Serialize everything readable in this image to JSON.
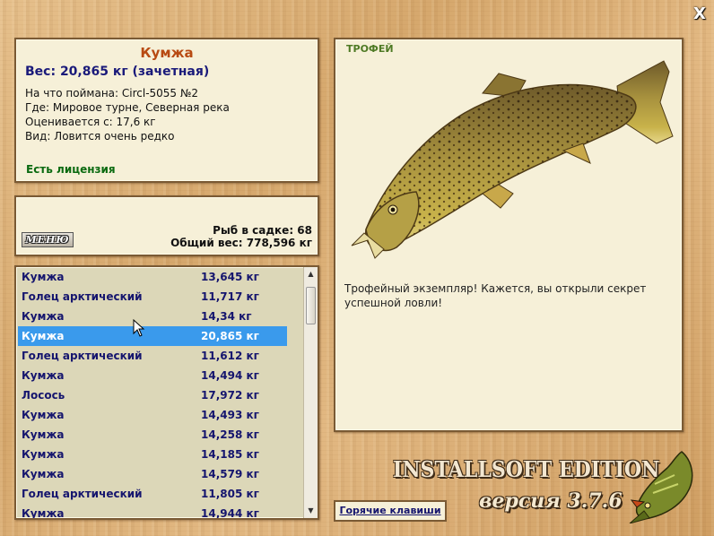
{
  "close_label": "X",
  "info": {
    "name": "Кумжа",
    "weight": "Вес: 20,865 кг (зачетная)",
    "lines": [
      "На что поймана: Circl-5055 №2",
      "Где: Мировое турне, Северная река",
      "Оценивается с: 17,6 кг",
      "Вид: Ловится очень редко"
    ],
    "license": "Есть лицензия"
  },
  "status": {
    "menu_label": "МЕНЮ",
    "fish_count": "Рыб в садке: 68",
    "total_weight": "Общий вес: 778,596 кг"
  },
  "catches": [
    {
      "name": "Кумжа",
      "weight": "13,645 кг"
    },
    {
      "name": "Голец арктический",
      "weight": "11,717 кг"
    },
    {
      "name": "Кумжа",
      "weight": "14,34 кг"
    },
    {
      "name": "Кумжа",
      "weight": "20,865 кг",
      "selected": true
    },
    {
      "name": "Голец арктический",
      "weight": "11,612 кг"
    },
    {
      "name": "Кумжа",
      "weight": "14,494 кг"
    },
    {
      "name": "Лосось",
      "weight": "17,972 кг"
    },
    {
      "name": "Кумжа",
      "weight": "14,493 кг"
    },
    {
      "name": "Кумжа",
      "weight": "14,258 кг"
    },
    {
      "name": "Кумжа",
      "weight": "14,185 кг"
    },
    {
      "name": "Кумжа",
      "weight": "14,579 кг"
    },
    {
      "name": "Голец арктический",
      "weight": "11,805 кг"
    },
    {
      "name": "Кумжа",
      "weight": "14,944 кг"
    }
  ],
  "trophy": {
    "title": "ТРОФЕЙ",
    "text": "Трофейный экземпляр! Кажется, вы открыли секрет успешной ловли!"
  },
  "logo": {
    "edition": "INSTALLSOFT EDITION",
    "version": "версия 3.7.6"
  },
  "hotkeys_label": "Горячие клавиши",
  "colors": {
    "highlight": "#3a9aec",
    "fish_name": "#b84a12",
    "catch_text": "#15156e",
    "license": "#0a6a10"
  }
}
